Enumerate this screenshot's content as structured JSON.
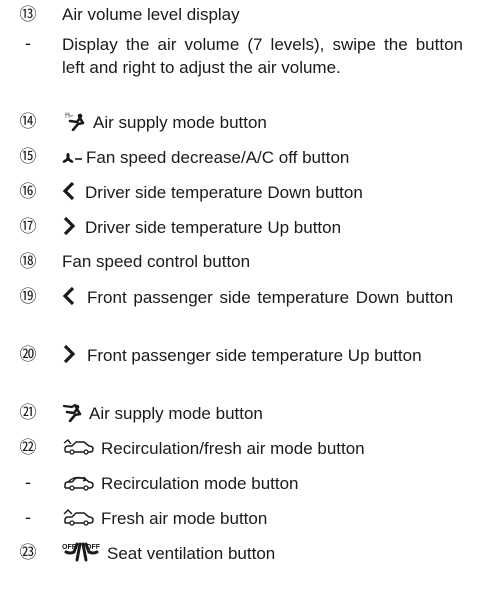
{
  "items": [
    {
      "marker": "⑬",
      "text": "Air volume level display"
    },
    {
      "marker": "-",
      "text": "Display the air volume (7 levels), swipe the button left and right to adjust the air volume."
    },
    {
      "marker": "⑭",
      "icon": "air-supply-mode-icon",
      "text": "Air supply mode button"
    },
    {
      "marker": "⑮",
      "icon": "fan-speed-decrease-icon",
      "text": "Fan speed decrease/A/C off button"
    },
    {
      "marker": "⑯",
      "icon": "chevron-left-icon",
      "text": "Driver side temperature Down button"
    },
    {
      "marker": "⑰",
      "icon": "chevron-right-icon",
      "text": "Driver side temperature Up button"
    },
    {
      "marker": "⑱",
      "text": "Fan speed control button"
    },
    {
      "marker": "⑲",
      "icon": "chevron-left-icon",
      "text": "Front passenger side temperature Down button"
    },
    {
      "marker": "⑳",
      "icon": "chevron-right-icon",
      "text": "Front passenger side temperature Up button"
    },
    {
      "marker": "㉑",
      "icon": "air-supply-mode-icon",
      "text": "Air supply mode button"
    },
    {
      "marker": "㉒",
      "icon": "recirculation-fresh-air-icon",
      "text": "Recirculation/fresh air mode button"
    },
    {
      "marker": "-",
      "icon": "recirculation-icon",
      "text": "Recirculation mode button"
    },
    {
      "marker": "-",
      "icon": "fresh-air-icon",
      "text": "Fresh air mode button"
    },
    {
      "marker": "㉓",
      "icon": "seat-ventilation-icon",
      "text": "Seat ventilation button"
    }
  ]
}
